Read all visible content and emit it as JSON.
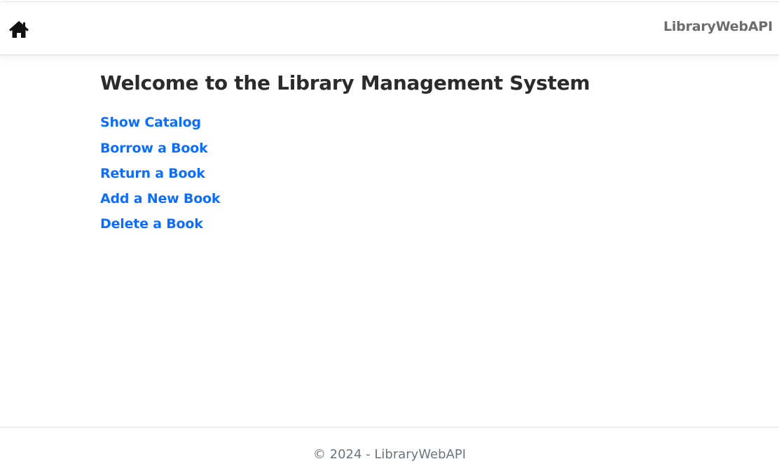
{
  "navbar": {
    "home_icon": "home-icon",
    "brand": "LibraryWebAPI"
  },
  "main": {
    "title": "Welcome to the Library Management System",
    "links": [
      {
        "label": "Show Catalog"
      },
      {
        "label": "Borrow a Book"
      },
      {
        "label": "Return a Book"
      },
      {
        "label": "Add a New Book"
      },
      {
        "label": "Delete a Book"
      }
    ]
  },
  "footer": {
    "text": "© 2024 - LibraryWebAPI"
  },
  "colors": {
    "link": "#0d6efd",
    "title": "#2b2b2b",
    "brand": "#6c6c6c",
    "footer_text": "#6c757d"
  }
}
